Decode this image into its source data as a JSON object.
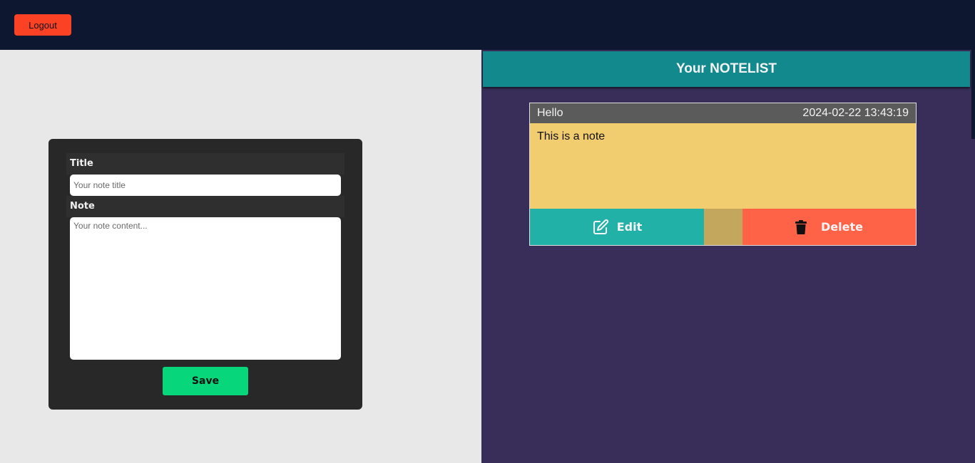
{
  "topbar": {
    "logout_label": "Logout"
  },
  "form": {
    "title_label": "Title",
    "title_placeholder": "Your note title",
    "title_value": "",
    "note_label": "Note",
    "note_placeholder": "Your note content...",
    "note_value": "",
    "save_label": "Save"
  },
  "notelist": {
    "header": "Your NOTELIST",
    "notes": [
      {
        "title": "Hello",
        "timestamp": "2024-02-22 13:43:19",
        "content": "This is a note",
        "edit_label": "Edit",
        "delete_label": "Delete"
      }
    ]
  },
  "icons": {
    "edit": "edit-icon",
    "delete": "trash-icon"
  },
  "colors": {
    "topbar": "#0d1730",
    "logout": "#fb4225",
    "save": "#08d67b",
    "notelist_header": "#12898d",
    "right_bg": "#382e59",
    "note_bg": "#f2cd6f",
    "edit": "#21b1a6",
    "delete": "#ff6347"
  }
}
